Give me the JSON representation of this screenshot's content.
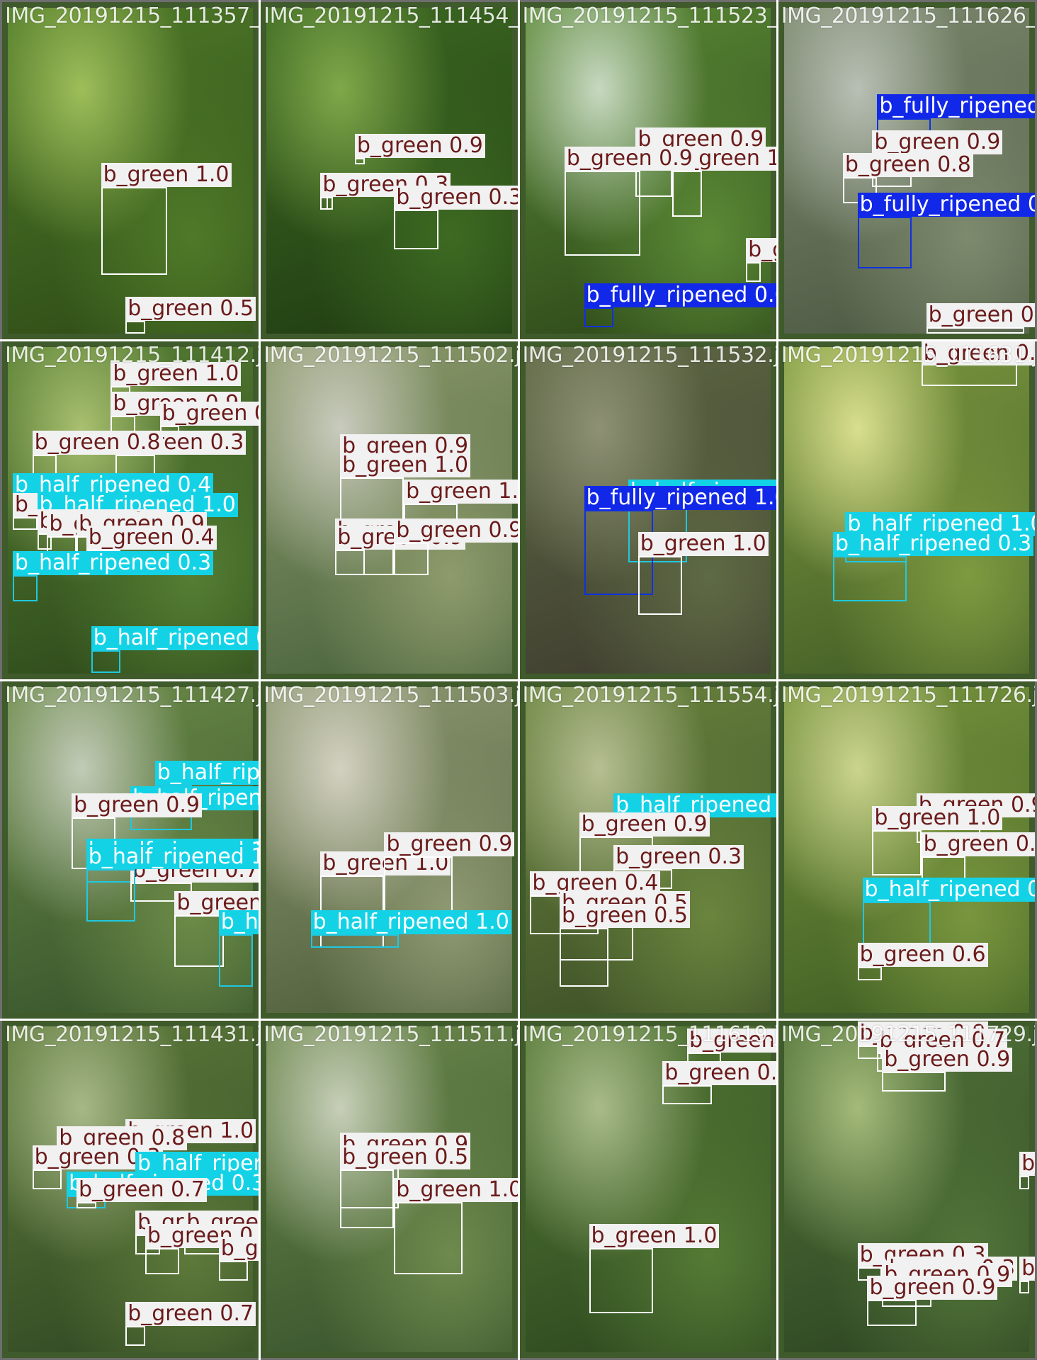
{
  "classes": {
    "b_green": {
      "box": "#ffffff",
      "bg": "#f1f1f1",
      "fg": "#6b1a1a"
    },
    "b_half_ripened": {
      "box": "#1fc8e0",
      "bg": "#14d2e6",
      "fg": "#ffffff"
    },
    "b_fully_ripened": {
      "box": "#1030e0",
      "bg": "#1228e8",
      "fg": "#ffffff"
    }
  },
  "tiles": [
    {
      "file": "IMG_20191215_111357_",
      "tint": [
        "#9ebe5a",
        "#4f7a28",
        "#2d4a17"
      ],
      "dets": [
        [
          "b_green",
          1.0,
          0.38,
          0.55,
          0.65,
          0.82
        ],
        [
          "b_green",
          0.5,
          0.48,
          0.96,
          0.56,
          1.0
        ]
      ]
    },
    {
      "file": "IMG_20191215_111454_",
      "tint": [
        "#7fa84a",
        "#3d6a22",
        "#1f3a12"
      ],
      "dets": [
        [
          "b_green",
          0.9,
          0.36,
          0.46,
          0.4,
          0.48
        ],
        [
          "b_green",
          0.7,
          0.22,
          0.58,
          0.27,
          0.62
        ],
        [
          "b_green",
          0.3,
          0.22,
          0.58,
          0.25,
          0.62
        ],
        [
          "b_green",
          0.3,
          0.52,
          0.62,
          0.7,
          0.74
        ]
      ]
    },
    {
      "file": "IMG_20191215_111523_",
      "tint": [
        "#c7d9c0",
        "#5b8a36",
        "#2a4417"
      ],
      "dets": [
        [
          "b_green",
          0.9,
          0.45,
          0.44,
          0.6,
          0.58
        ],
        [
          "b_green",
          1.0,
          0.6,
          0.5,
          0.72,
          0.64
        ],
        [
          "b_green",
          0.9,
          0.16,
          0.5,
          0.47,
          0.76
        ],
        [
          "b_green",
          1.0,
          0.9,
          0.78,
          0.96,
          0.84
        ],
        [
          "b_fully_ripened",
          0.6,
          0.24,
          0.92,
          0.36,
          0.98
        ]
      ]
    },
    {
      "file": "IMG_20191215_111626_",
      "tint": [
        "#b8bfb4",
        "#7d8a6e",
        "#4a5540"
      ],
      "dets": [
        [
          "b_fully_ripened",
          0.7,
          0.38,
          0.34,
          0.6,
          0.5
        ],
        [
          "b_green",
          0.9,
          0.36,
          0.45,
          0.52,
          0.55
        ],
        [
          "b_green",
          0.8,
          0.24,
          0.52,
          0.38,
          0.6
        ],
        [
          "b_fully_ripened",
          0.9,
          0.3,
          0.64,
          0.52,
          0.8
        ],
        [
          "b_green",
          0.8,
          0.58,
          0.98,
          0.98,
          1.0
        ]
      ]
    },
    {
      "file": "IMG_20191215_111412.jpg",
      "tint": [
        "#a9c06f",
        "#557e33",
        "#2b4619"
      ],
      "dets": [
        [
          "b_green",
          1.0,
          0.42,
          0.12,
          0.5,
          0.2
        ],
        [
          "b_green",
          0.9,
          0.42,
          0.21,
          0.52,
          0.28
        ],
        [
          "b_green",
          0.9,
          0.62,
          0.24,
          0.7,
          0.3
        ],
        [
          "b_green",
          0.3,
          0.44,
          0.33,
          0.6,
          0.4
        ],
        [
          "b_green",
          0.8,
          0.1,
          0.33,
          0.2,
          0.4
        ],
        [
          "b_half_ripened",
          0.4,
          0.02,
          0.46,
          0.18,
          0.5
        ],
        [
          "b_green",
          0.3,
          0.02,
          0.52,
          0.12,
          0.56
        ],
        [
          "b_half_ripened",
          1.0,
          0.12,
          0.52,
          0.2,
          0.56
        ],
        [
          "b_green",
          0.5,
          0.12,
          0.57,
          0.18,
          0.62
        ],
        [
          "b_green",
          0.8,
          0.16,
          0.58,
          0.28,
          0.64
        ],
        [
          "b_green",
          0.9,
          0.28,
          0.58,
          0.42,
          0.64
        ],
        [
          "b_green",
          0.4,
          0.32,
          0.62,
          0.46,
          0.68
        ],
        [
          "b_half_ripened",
          0.3,
          0.02,
          0.7,
          0.12,
          0.78
        ],
        [
          "b_half_ripened",
          0.9,
          0.34,
          0.93,
          0.46,
          1.0
        ]
      ]
    },
    {
      "file": "IMG_20191215_111502.jpg",
      "tint": [
        "#c9cbbd",
        "#8e9b6c",
        "#45603a"
      ],
      "dets": [
        [
          "b_green",
          0.9,
          0.3,
          0.34,
          0.4,
          0.4
        ],
        [
          "b_green",
          1.0,
          0.3,
          0.4,
          0.56,
          0.56
        ],
        [
          "b_green",
          1.0,
          0.56,
          0.48,
          0.78,
          0.62
        ],
        [
          "b_green",
          0.9,
          0.28,
          0.6,
          0.52,
          0.7
        ],
        [
          "b_green",
          0.9,
          0.28,
          0.62,
          0.4,
          0.7
        ],
        [
          "b_green",
          0.9,
          0.52,
          0.6,
          0.66,
          0.7
        ]
      ]
    },
    {
      "file": "IMG_20191215_111532.jpg",
      "tint": [
        "#8e9174",
        "#5e6a44",
        "#3d3a2e"
      ],
      "dets": [
        [
          "b_half_ripened",
          0.5,
          0.42,
          0.48,
          0.66,
          0.66
        ],
        [
          "b_fully_ripened",
          1.0,
          0.24,
          0.5,
          0.52,
          0.76
        ],
        [
          "b_green",
          1.0,
          0.46,
          0.64,
          0.64,
          0.82
        ]
      ]
    },
    {
      "file": "IMG_20191215_111631.jpg",
      "tint": [
        "#d9df8e",
        "#7e9a40",
        "#3f5a24"
      ],
      "dets": [
        [
          "b_green",
          0.8,
          0.56,
          0.02,
          0.95,
          0.12
        ],
        [
          "b_half_ripened",
          1.0,
          0.25,
          0.58,
          0.5,
          0.66
        ],
        [
          "b_half_ripened",
          0.3,
          0.2,
          0.64,
          0.5,
          0.78
        ]
      ]
    },
    {
      "file": "IMG_20191215_111427.jpg",
      "tint": [
        "#c2cbb7",
        "#6c8b48",
        "#33512a"
      ],
      "dets": [
        [
          "b_half_ripened",
          1.0,
          0.6,
          0.3,
          0.75,
          0.36
        ],
        [
          "b_half_ripened",
          1.0,
          0.5,
          0.38,
          0.75,
          0.44
        ],
        [
          "b_green",
          0.9,
          0.26,
          0.4,
          0.44,
          0.56
        ],
        [
          "b_half_ripened",
          1.0,
          0.32,
          0.54,
          0.7,
          0.6
        ],
        [
          "b_green",
          0.7,
          0.5,
          0.6,
          0.75,
          0.66
        ],
        [
          "b_half_ripened",
          1.0,
          0.32,
          0.56,
          0.52,
          0.72
        ],
        [
          "b_green",
          0.9,
          0.68,
          0.7,
          0.88,
          0.86
        ],
        [
          "b_half_ripened",
          1.0,
          0.86,
          0.76,
          1.0,
          0.92
        ]
      ]
    },
    {
      "file": "IMG_20191215_111503.jpg",
      "tint": [
        "#d3d1c1",
        "#8f9a73",
        "#4b5b37"
      ],
      "dets": [
        [
          "b_green",
          1.0,
          0.22,
          0.58,
          0.48,
          0.8
        ],
        [
          "b_green",
          0.9,
          0.48,
          0.52,
          0.76,
          0.76
        ],
        [
          "b_half_ripened",
          1.0,
          0.18,
          0.76,
          0.54,
          0.8
        ]
      ]
    },
    {
      "file": "IMG_20191215_111554.jpg",
      "tint": [
        "#b6bf92",
        "#6a853e",
        "#3b4c26"
      ],
      "dets": [
        [
          "b_half_ripened",
          1.0,
          0.36,
          0.4,
          0.6,
          0.46
        ],
        [
          "b_green",
          0.9,
          0.22,
          0.46,
          0.52,
          0.58
        ],
        [
          "b_green",
          0.3,
          0.36,
          0.56,
          0.6,
          0.62
        ],
        [
          "b_green",
          0.4,
          0.02,
          0.64,
          0.3,
          0.76
        ],
        [
          "b_green",
          0.5,
          0.14,
          0.7,
          0.44,
          0.84
        ],
        [
          "b_green",
          0.5,
          0.14,
          0.74,
          0.34,
          0.92
        ]
      ]
    },
    {
      "file": "IMG_20191215_111726.jpg",
      "tint": [
        "#cbd48e",
        "#79963e",
        "#3c5a22"
      ],
      "dets": [
        [
          "b_green",
          0.9,
          0.54,
          0.4,
          0.8,
          0.48
        ],
        [
          "b_green",
          1.0,
          0.36,
          0.44,
          0.56,
          0.58
        ],
        [
          "b_green",
          0.9,
          0.56,
          0.52,
          0.74,
          0.6
        ],
        [
          "b_half_ripened",
          0.8,
          0.32,
          0.66,
          0.6,
          0.84
        ],
        [
          "b_green",
          0.6,
          0.3,
          0.86,
          0.4,
          0.9
        ]
      ]
    },
    {
      "file": "IMG_20191215_111431.jpg",
      "tint": [
        "#a7b887",
        "#5d7a3a",
        "#2f4622"
      ],
      "dets": [
        [
          "b_green",
          1.0,
          0.48,
          0.36,
          0.62,
          0.42
        ],
        [
          "b_green",
          0.8,
          0.2,
          0.38,
          0.32,
          0.44
        ],
        [
          "b_green",
          0.3,
          0.1,
          0.44,
          0.22,
          0.5
        ],
        [
          "b_half_ripened",
          0.5,
          0.52,
          0.46,
          0.62,
          0.5
        ],
        [
          "b_half_ripened",
          0.3,
          0.24,
          0.52,
          0.4,
          0.56
        ],
        [
          "b_green",
          0.7,
          0.28,
          0.54,
          0.36,
          0.56
        ],
        [
          "b_green",
          0.4,
          0.52,
          0.64,
          0.62,
          0.7
        ],
        [
          "b_green",
          0.9,
          0.72,
          0.64,
          0.88,
          0.7
        ],
        [
          "b_green",
          0.9,
          0.56,
          0.68,
          0.7,
          0.76
        ],
        [
          "b_green",
          1.0,
          0.86,
          0.72,
          0.98,
          0.78
        ],
        [
          "b_green",
          0.7,
          0.48,
          0.92,
          0.56,
          0.98
        ]
      ]
    },
    {
      "file": "IMG_20191215_111511.jpg",
      "tint": [
        "#c7cfb8",
        "#6e8a4d",
        "#34502a"
      ],
      "dets": [
        [
          "b_green",
          0.9,
          0.3,
          0.4,
          0.54,
          0.56
        ],
        [
          "b_green",
          0.5,
          0.3,
          0.44,
          0.52,
          0.62
        ],
        [
          "b_green",
          1.0,
          0.52,
          0.54,
          0.8,
          0.76
        ]
      ]
    },
    {
      "file": "IMG_20191215_111619.jpg",
      "tint": [
        "#a9bb8a",
        "#557a35",
        "#2a451e"
      ],
      "dets": [
        [
          "b_green",
          0.9,
          0.66,
          0.08,
          0.8,
          0.14
        ],
        [
          "b_green",
          0.5,
          0.56,
          0.18,
          0.76,
          0.24
        ],
        [
          "b_green",
          1.0,
          0.26,
          0.68,
          0.52,
          0.88
        ]
      ]
    },
    {
      "file": "IMG_20191215_111729.jpg",
      "tint": [
        "#a4ba7a",
        "#53763a",
        "#2b4221"
      ],
      "dets": [
        [
          "b_green",
          0.9,
          0.3,
          0.06,
          0.4,
          0.1
        ],
        [
          "b_green",
          0.7,
          0.38,
          0.08,
          0.6,
          0.14
        ],
        [
          "b_green",
          0.9,
          0.4,
          0.14,
          0.66,
          0.2
        ],
        [
          "b_green",
          0.3,
          0.96,
          0.46,
          1.0,
          0.5
        ],
        [
          "b_green",
          0.3,
          0.3,
          0.74,
          0.4,
          0.78
        ],
        [
          "b_green",
          0.3,
          0.42,
          0.78,
          0.56,
          0.82
        ],
        [
          "b_green",
          0.9,
          0.4,
          0.8,
          0.6,
          0.86
        ],
        [
          "b_green",
          0.9,
          0.34,
          0.84,
          0.54,
          0.92
        ],
        [
          "b_green",
          0.5,
          0.96,
          0.78,
          1.0,
          0.82
        ]
      ]
    }
  ]
}
